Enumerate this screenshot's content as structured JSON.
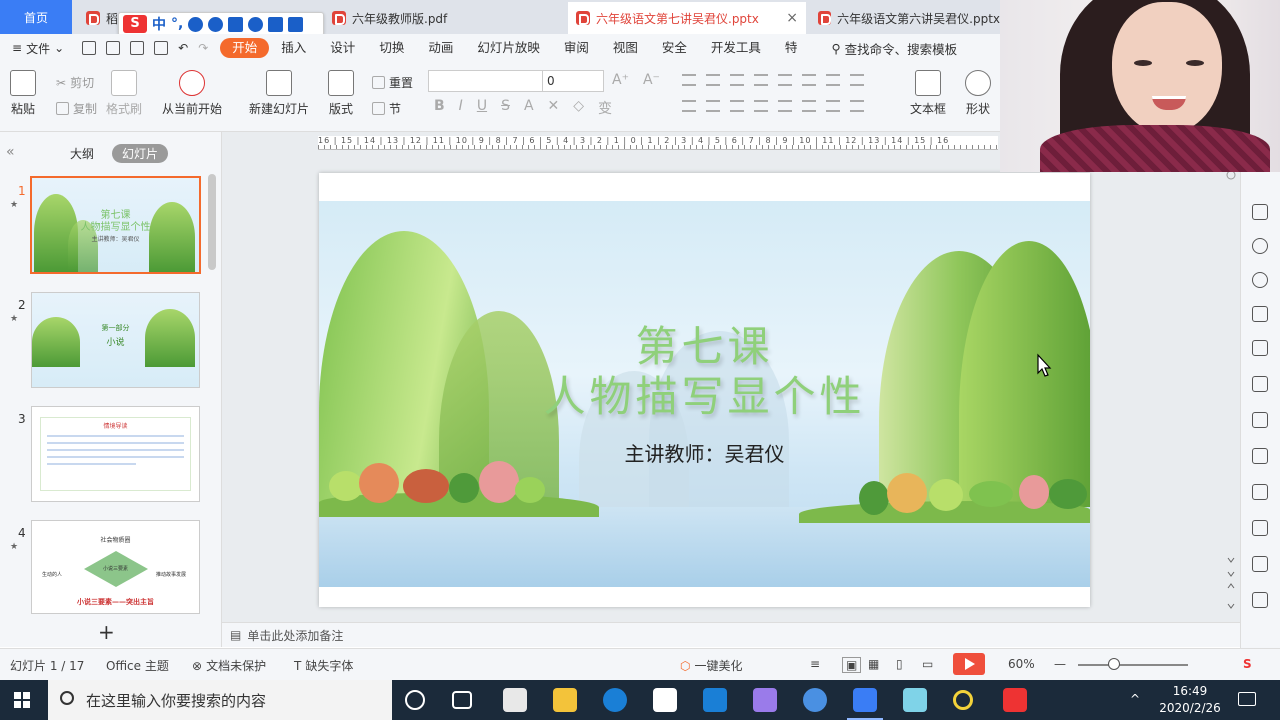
{
  "tabs": {
    "home": "首页",
    "tab1": "稻壳商城",
    "tab2": "六年级教师版.pdf",
    "tab3": "六年级语文第七讲吴君仪.pptx",
    "tab4": "六年级语文第六讲吴君仪.pptx",
    "close": "×"
  },
  "ime": {
    "logo": "S",
    "mode": "中",
    "punct": "°,"
  },
  "menu": {
    "file": "文件",
    "tabs": [
      "开始",
      "插入",
      "设计",
      "切换",
      "动画",
      "幻灯片放映",
      "审阅",
      "视图",
      "安全",
      "开发工具",
      "特"
    ],
    "search": "查找命令、搜索模板"
  },
  "ribbon": {
    "paste": "粘贴",
    "cut": "剪切",
    "copy": "复制",
    "format_painter": "格式刷",
    "from_current": "从当前开始",
    "new_slide": "新建幻灯片",
    "layout": "版式",
    "reset": "重置",
    "section": "节",
    "font_size": "0",
    "textbox": "文本框",
    "shape": "形状"
  },
  "panel": {
    "outline_tab": "大纲",
    "slides_tab": "幻灯片",
    "thumbs": [
      {
        "num": "1",
        "line1": "第七课",
        "line2": "人物描写显个性",
        "line3": "主讲教师：吴君仪"
      },
      {
        "num": "2",
        "line1": "第一部分",
        "line2": "小说"
      },
      {
        "num": "3",
        "line1": "情境导读"
      },
      {
        "num": "4",
        "line1": "社会物质圈",
        "line2": "小说三要素",
        "line3": "小说三要素——突出主旨",
        "left": "生动的人",
        "right": "推动故事发展"
      }
    ],
    "add": "+"
  },
  "ruler": "16 | 15 | 14 | 13 | 12 | 11 | 10 | 9 | 8 | 7 | 6 | 5 | 4 | 3 | 2 | 1 | 0 | 1 | 2 | 3 | 4 | 5 | 6 | 7 | 8 | 9 | 10 | 11 | 12 | 13 | 14 | 15 | 16",
  "slide": {
    "title_line1": "第七课",
    "title_line2": "人物描写显个性",
    "teacher": "主讲教师：吴君仪"
  },
  "notes": {
    "placeholder": "单击此处添加备注"
  },
  "status": {
    "slide_count": "幻灯片 1 / 17",
    "theme": "Office 主题",
    "protect": "文档未保护",
    "missing_font": "缺失字体",
    "beautify": "一键美化",
    "zoom": "60%"
  },
  "taskbar": {
    "search_placeholder": "在这里输入你要搜索的内容",
    "time": "16:49",
    "date": "2020/2/26"
  },
  "colors": {
    "accent": "#f46a2c",
    "brand_blue": "#3a7df5",
    "title_green": "#8fd07a",
    "play_red": "#ef4f3c"
  }
}
